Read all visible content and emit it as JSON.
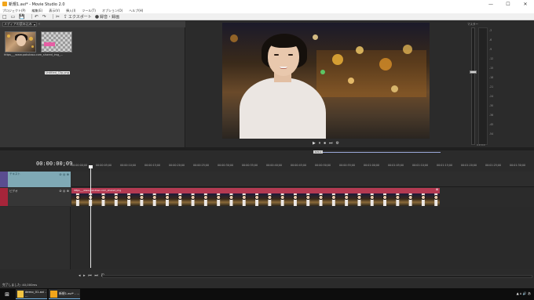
{
  "window": {
    "title": "新規1.avi* - Movie Studio 2.0",
    "controls": [
      "—",
      "☐",
      "✕"
    ]
  },
  "menu": {
    "items": [
      "プロジェクト(P)",
      "編集(E)",
      "表示(V)",
      "挿入(I)",
      "ツール(T)",
      "オプション(O)",
      "ヘルプ(H)"
    ]
  },
  "toolbar": {
    "buttons": [
      "□",
      "▭",
      "💾",
      "↶",
      "↷",
      "✂"
    ],
    "export_label": "エクスポート",
    "record_label": "録音・録画"
  },
  "media": {
    "dropdown_label": "メディアの読み込み",
    "thumb1_caption": "https___www.pakutaso.com_shared_img_...",
    "thumb2_caption": "Untitled_Clip.png",
    "tabs": [
      "トランジション",
      "ビデオFX",
      "メディアジェネレーター",
      "メディアジェネレーター"
    ]
  },
  "preview": {
    "controls": [
      "▶",
      "⏸",
      "⏹",
      "⏭",
      "⚙"
    ],
    "tab_label": "ビデオプレビュー"
  },
  "meter": {
    "label": "マスター",
    "scale": [
      "-3",
      "-6",
      "-9",
      "-12",
      "-15",
      "-18",
      "-21",
      "-24",
      "-30",
      "-36",
      "-45",
      "-54"
    ],
    "bottom": "0.0 0.0",
    "tab_label": "マスターバス"
  },
  "timeline": {
    "timecode": "00:00:00;09",
    "scrub_label": "0.5 x",
    "ruler": [
      "00:00:00;00",
      "00:00:05;00",
      "00:00:10;00",
      "00:00:15;00",
      "00:00:20;00",
      "00:00:25;00",
      "00:00:30;00",
      "00:00:35;00",
      "00:00:40;00",
      "00:00:45;00",
      "00:00:50;00",
      "00:00:55;00",
      "00:01:00;00",
      "00:01:05;00",
      "00:01:10;00",
      "00:01:15;00",
      "00:01:20;00",
      "00:01:25;00",
      "00:01:30;00"
    ],
    "overlay_track_label": "テキスト",
    "video_track_label": "ビデオ",
    "clip_title": "https___www.pakutaso.com_shared_img",
    "track_icons": "⊘ ◎ ⊕",
    "bottom_controls": [
      "◂",
      "▸",
      "⏮",
      "⏭",
      "⊞"
    ]
  },
  "status": {
    "message": "完了しました: 40,000ms"
  },
  "taskbar": {
    "start_icon": "⊞",
    "tasks": [
      {
        "label": "demo_01.avi - ...",
        "color": "#f4c542"
      },
      {
        "label": "新規1.avi* - ...",
        "color": "#f2a51a"
      }
    ],
    "tray": "▲ ⌂ 🔊 あ"
  }
}
